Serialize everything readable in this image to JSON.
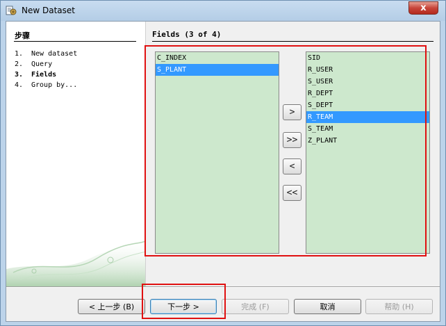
{
  "window": {
    "title": "New Dataset",
    "close_label": "x"
  },
  "left": {
    "title": "步骤",
    "steps": [
      {
        "num": "1.",
        "label": "New dataset",
        "current": false
      },
      {
        "num": "2.",
        "label": "Query",
        "current": false
      },
      {
        "num": "3.",
        "label": "Fields",
        "current": true
      },
      {
        "num": "4.",
        "label": "Group by...",
        "current": false
      }
    ]
  },
  "right": {
    "title": "Fields (3 of 4)"
  },
  "available_list": {
    "items": [
      "C_INDEX",
      "S_PLANT"
    ],
    "selected_index": 1
  },
  "selected_list": {
    "items": [
      "SID",
      "R_USER",
      "S_USER",
      "R_DEPT",
      "S_DEPT",
      "R_TEAM",
      "S_TEAM",
      "Z_PLANT"
    ],
    "selected_index": 5
  },
  "transfer_buttons": {
    "add": ">",
    "add_all": ">>",
    "remove": "<",
    "remove_all": "<<"
  },
  "footer": {
    "back": "< 上一步 (B)",
    "next": "下一步 >",
    "finish": "完成 (F)",
    "cancel": "取消",
    "help": "帮助 (H)"
  },
  "colors": {
    "list_bg": "#cde8cd",
    "selection": "#3399ff",
    "highlight": "#e01010"
  },
  "icons": {
    "app": "dataset-wizard-icon",
    "close": "close-icon"
  }
}
